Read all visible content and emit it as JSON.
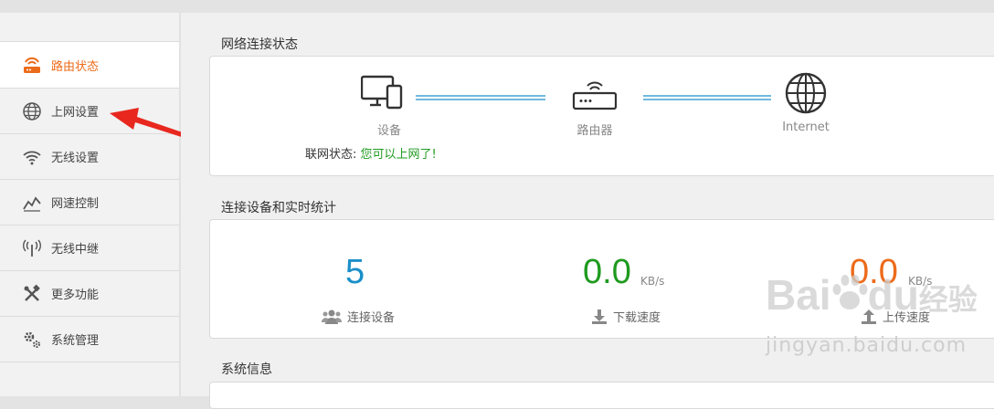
{
  "sidebar": {
    "items": [
      {
        "label": "路由状态",
        "icon": "router-icon",
        "active": true
      },
      {
        "label": "上网设置",
        "icon": "globe-icon"
      },
      {
        "label": "无线设置",
        "icon": "wifi-icon"
      },
      {
        "label": "网速控制",
        "icon": "speed-chart-icon"
      },
      {
        "label": "无线中继",
        "icon": "antenna-icon"
      },
      {
        "label": "更多功能",
        "icon": "tools-icon"
      },
      {
        "label": "系统管理",
        "icon": "gears-icon"
      }
    ]
  },
  "network_status": {
    "title": "网络连接状态",
    "devices_label": "设备",
    "router_label": "路由器",
    "internet_label": "Internet",
    "status_prefix": "联网状态:",
    "status_text": "您可以上网了!"
  },
  "stats": {
    "title": "连接设备和实时统计",
    "connected_count": "5",
    "connected_label": "连接设备",
    "download_value": "0.0",
    "download_unit": "KB/s",
    "download_label": "下载速度",
    "upload_value": "0.0",
    "upload_unit": "KB/s",
    "upload_label": "上传速度"
  },
  "system_info": {
    "title": "系统信息"
  },
  "watermark": {
    "brand": "Bai",
    "brand2": "du",
    "brand3": "经验",
    "url": "jingyan.baidu.com"
  },
  "colors": {
    "accent": "#ec6b1a",
    "ok": "#1f9a1f",
    "blue": "#1a8fc9",
    "green": "#1f9a1f",
    "orange": "#ec6b1a"
  }
}
